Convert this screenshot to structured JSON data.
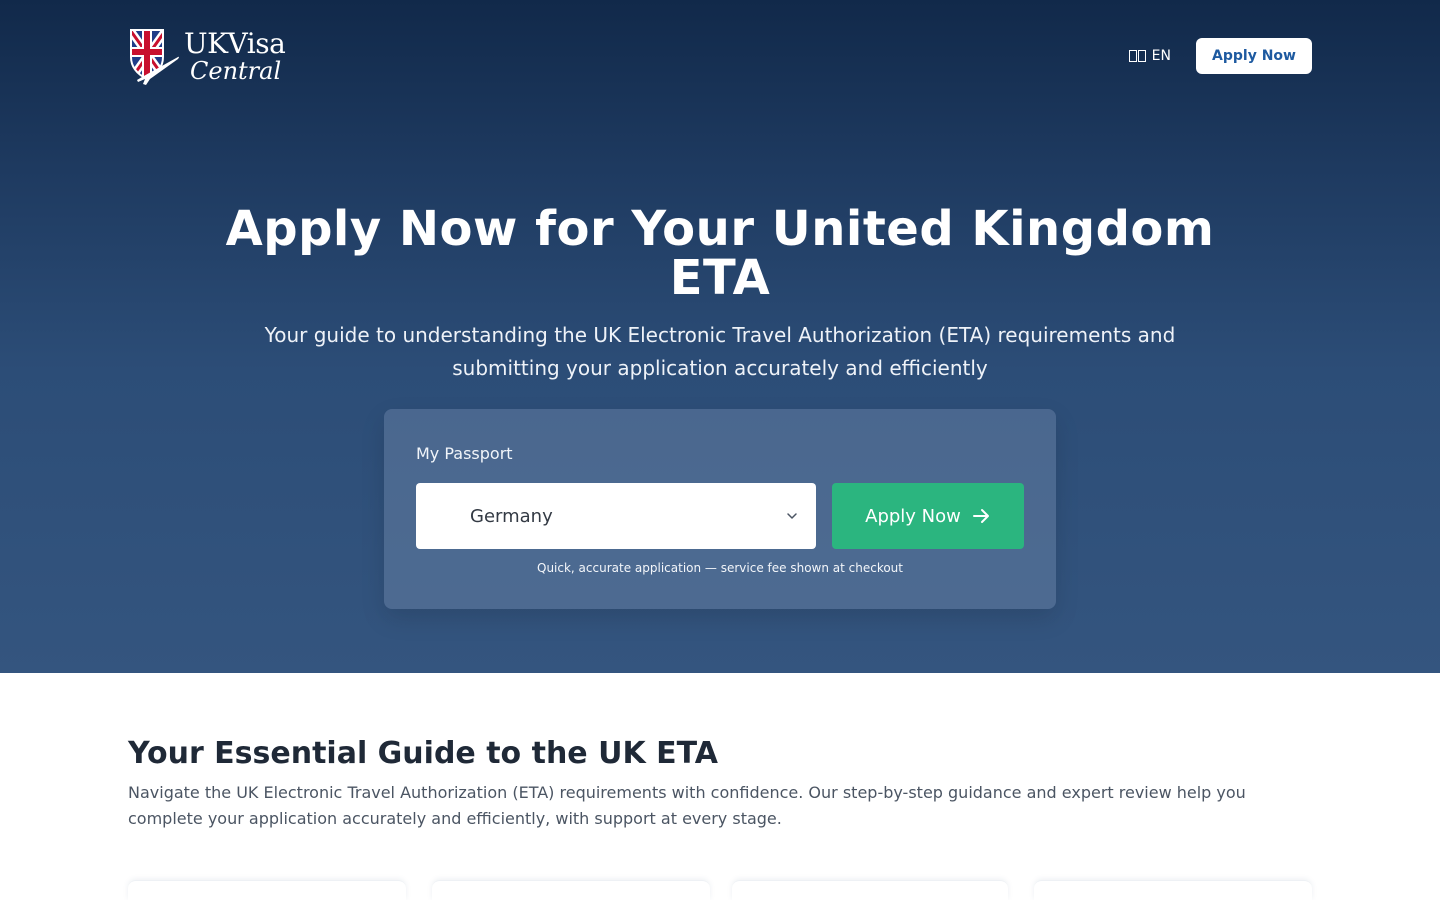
{
  "header": {
    "logo_line1": "UKVisa",
    "logo_line2": "Central",
    "language": "EN",
    "apply_button": "Apply Now"
  },
  "hero": {
    "title": "Apply Now for Your United Kingdom ETA",
    "subtitle": "Your guide to understanding the UK Electronic Travel Authorization (ETA) requirements and submitting your application accurately and efficiently"
  },
  "form": {
    "passport_label": "My Passport",
    "selected_country": "Germany",
    "apply_button": "Apply Now",
    "note": "Quick, accurate application — service fee shown at checkout"
  },
  "guide": {
    "title": "Your Essential Guide to the UK ETA",
    "text": "Navigate the UK Electronic Travel Authorization (ETA) requirements with confidence. Our step-by-step guidance and expert review help you complete your application accurately and efficiently, with support at every stage."
  },
  "colors": {
    "hero_top": "#11294a",
    "hero_bottom": "#34557f",
    "apply_green": "#2bb57f",
    "brand_blue": "#1e5aa0"
  },
  "icons": [
    "uk-flag-plane-logo-icon",
    "flag-icon",
    "chevron-down-icon",
    "arrow-right-icon"
  ]
}
